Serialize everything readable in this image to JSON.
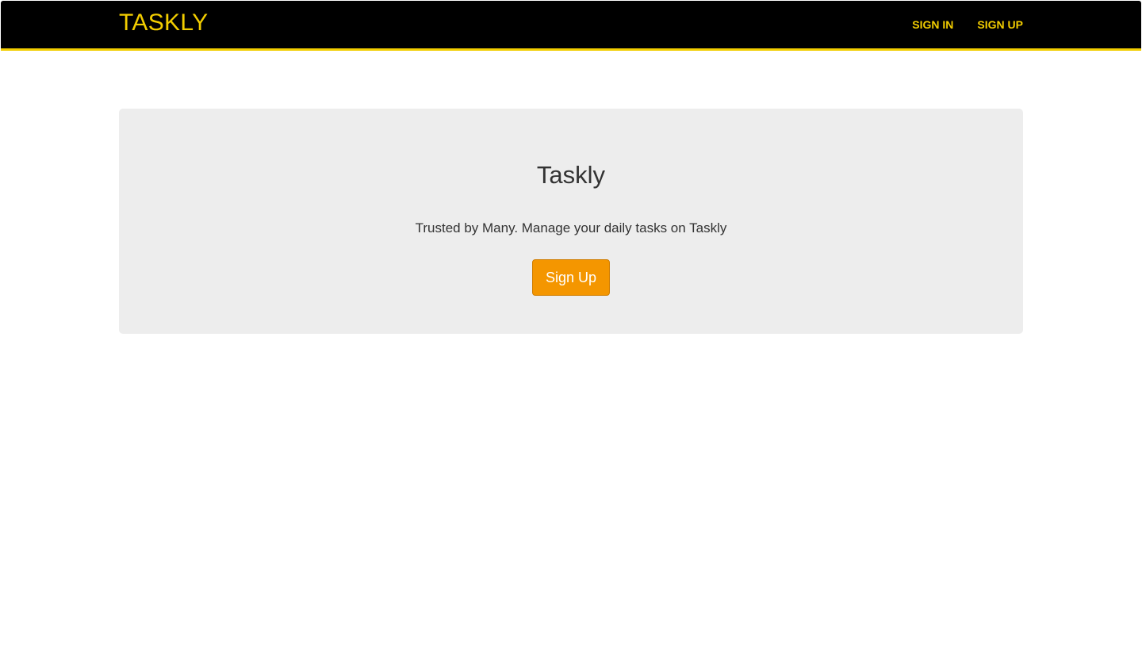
{
  "navbar": {
    "brand": "TASKLY",
    "links": [
      {
        "label": "SIGN IN"
      },
      {
        "label": "SIGN UP"
      }
    ],
    "background_color": "#000000",
    "accent_color": "#f2cd00"
  },
  "hero": {
    "title": "Taskly",
    "tagline": "Trusted by Many. Manage your daily tasks on Taskly",
    "button_label": "Sign Up",
    "background_color": "#ededed",
    "button_color": "#f49600"
  }
}
